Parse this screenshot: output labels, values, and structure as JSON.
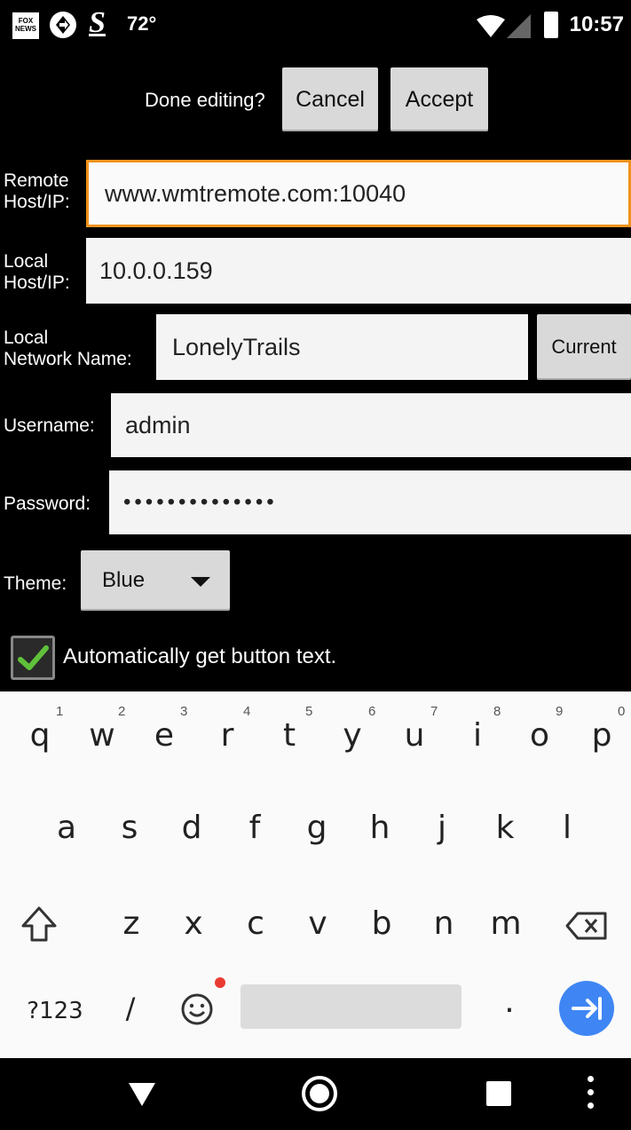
{
  "status_bar": {
    "news_icon_text": "FOX NEWS",
    "temperature": "72°",
    "time": "10:57"
  },
  "header": {
    "prompt": "Done editing?",
    "cancel_label": "Cancel",
    "accept_label": "Accept"
  },
  "form": {
    "remote_host": {
      "label_line1": "Remote",
      "label_line2": "Host/IP:",
      "value": "www.wmtremote.com:10040"
    },
    "local_host": {
      "label_line1": "Local",
      "label_line2": "Host/IP:",
      "value": "10.0.0.159"
    },
    "network_name": {
      "label_line1": "Local",
      "label_line2": "Network Name:",
      "value": "LonelyTrails",
      "current_label": "Current"
    },
    "username": {
      "label": "Username:",
      "value": "admin"
    },
    "password": {
      "label": "Password:",
      "value": "••••••••••••••"
    },
    "theme": {
      "label": "Theme:",
      "value": "Blue"
    },
    "auto_text": {
      "label": "Automatically get button text.",
      "checked": true
    }
  },
  "keyboard": {
    "row1": [
      "q",
      "w",
      "e",
      "r",
      "t",
      "y",
      "u",
      "i",
      "o",
      "p"
    ],
    "row1_hints": [
      "1",
      "2",
      "3",
      "4",
      "5",
      "6",
      "7",
      "8",
      "9",
      "0"
    ],
    "row2": [
      "a",
      "s",
      "d",
      "f",
      "g",
      "h",
      "j",
      "k",
      "l"
    ],
    "row3": [
      "z",
      "x",
      "c",
      "v",
      "b",
      "n",
      "m"
    ],
    "symbols_label": "?123",
    "slash_label": "/",
    "period_label": "."
  },
  "colors": {
    "focus_border": "#f0921c",
    "checkbox_check": "#5fc13a",
    "enter_key": "#3f86f4",
    "notification_dot": "#ea3b33"
  }
}
